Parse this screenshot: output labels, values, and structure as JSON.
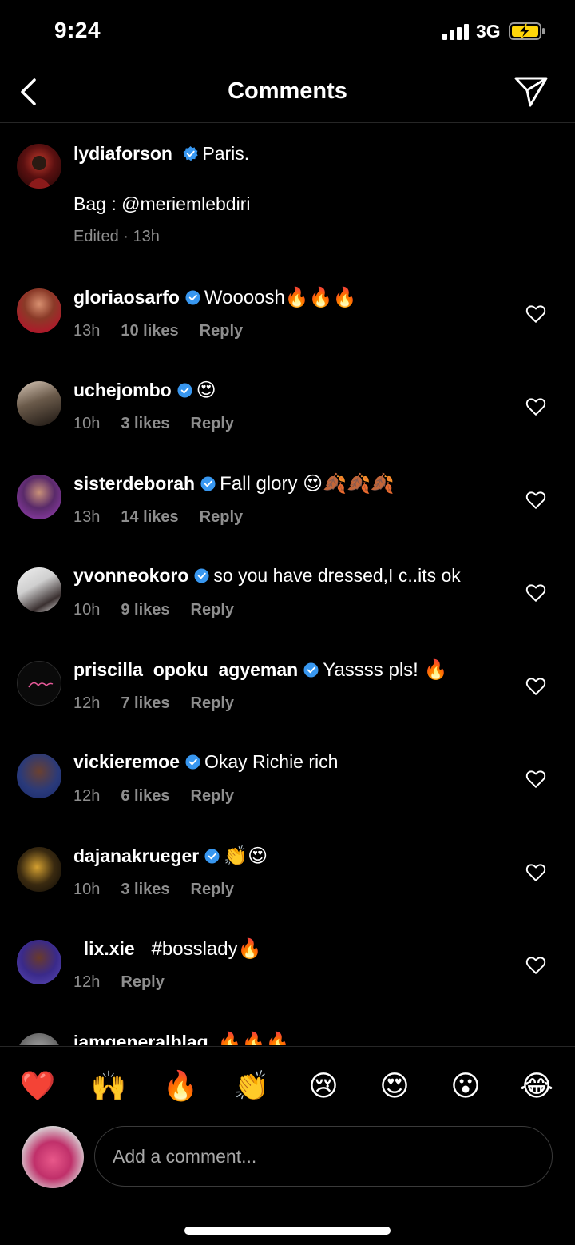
{
  "status_bar": {
    "time": "9:24",
    "network": "3G"
  },
  "header": {
    "title": "Comments",
    "back_icon": "chevron-left-icon",
    "send_icon": "paper-plane-icon"
  },
  "caption": {
    "username": "lydiaforson",
    "text": "Paris.",
    "text2": "Bag : @meriemlebdiri",
    "meta": "Edited · 13h"
  },
  "comments": [
    {
      "username": "gloriaosarfo",
      "verified": true,
      "text": "Woooosh🔥🔥🔥",
      "time": "13h",
      "likes": "10 likes",
      "reply": "Reply"
    },
    {
      "username": "uchejombo",
      "verified": true,
      "text": "😍",
      "time": "10h",
      "likes": "3 likes",
      "reply": "Reply"
    },
    {
      "username": "sisterdeborah",
      "verified": true,
      "text": "Fall glory 😍🍂🍂🍂",
      "time": "13h",
      "likes": "14 likes",
      "reply": "Reply"
    },
    {
      "username": "yvonneokoro",
      "verified": true,
      "text": "so you have dressed,I c..its ok",
      "time": "10h",
      "likes": "9 likes",
      "reply": "Reply"
    },
    {
      "username": "priscilla_opoku_agyeman",
      "verified": true,
      "text": "Yassss pls! 🔥",
      "time": "12h",
      "likes": "7 likes",
      "reply": "Reply"
    },
    {
      "username": "vickieremoe",
      "verified": true,
      "text": "Okay Richie rich",
      "time": "12h",
      "likes": "6 likes",
      "reply": "Reply"
    },
    {
      "username": "dajanakrueger",
      "verified": true,
      "text": "👏😍",
      "time": "10h",
      "likes": "3 likes",
      "reply": "Reply"
    },
    {
      "username": "_lix.xie_",
      "verified": false,
      "text": "#bosslady🔥",
      "time": "12h",
      "likes": "",
      "reply": "Reply"
    },
    {
      "username": "iamgeneralblag",
      "verified": false,
      "text": "🔥🔥🔥",
      "time": "",
      "likes": "",
      "reply": ""
    }
  ],
  "emoji_bar": [
    "❤️",
    "🙌",
    "🔥",
    "👏",
    "😢",
    "😍",
    "😮",
    "😂"
  ],
  "composer": {
    "placeholder": "Add a comment..."
  },
  "colors": {
    "background": "#000000",
    "secondary_text": "#8e8e8e",
    "verified_badge": "#3897f0",
    "divider": "#262626"
  }
}
